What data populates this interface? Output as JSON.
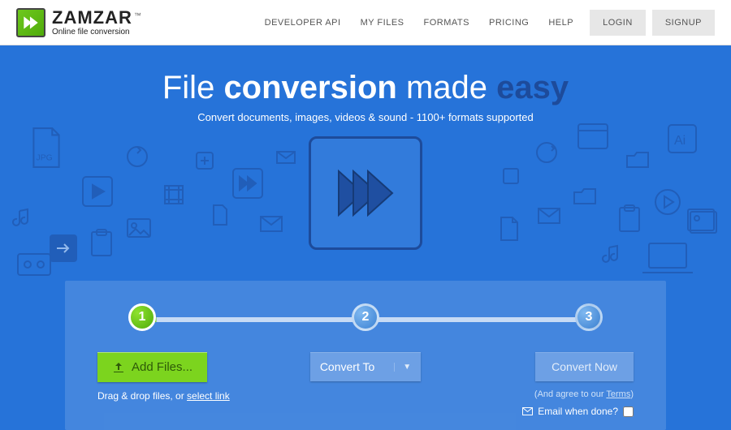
{
  "brand": {
    "name": "ZAMZAR",
    "tm": "™",
    "tagline": "Online file conversion"
  },
  "nav": {
    "developer": "DEVELOPER API",
    "myfiles": "MY FILES",
    "formats": "FORMATS",
    "pricing": "PRICING",
    "help": "HELP",
    "login": "LOGIN",
    "signup": "SIGNUP"
  },
  "hero": {
    "t1": "File ",
    "t2": "conversion",
    "t3": " made ",
    "t4": "easy",
    "sub": "Convert documents, images, videos & sound - 1100+ formats supported"
  },
  "steps": {
    "s1": "1",
    "s2": "2",
    "s3": "3"
  },
  "add": {
    "label": "Add Files..."
  },
  "dragdrop": {
    "pre": "Drag & drop files, or ",
    "link": "select link"
  },
  "convertTo": {
    "label": "Convert To"
  },
  "convertNow": {
    "label": "Convert Now"
  },
  "terms": {
    "pre": "(And agree to our ",
    "link": "Terms",
    "post": ")"
  },
  "email": {
    "label": "Email when done?"
  }
}
